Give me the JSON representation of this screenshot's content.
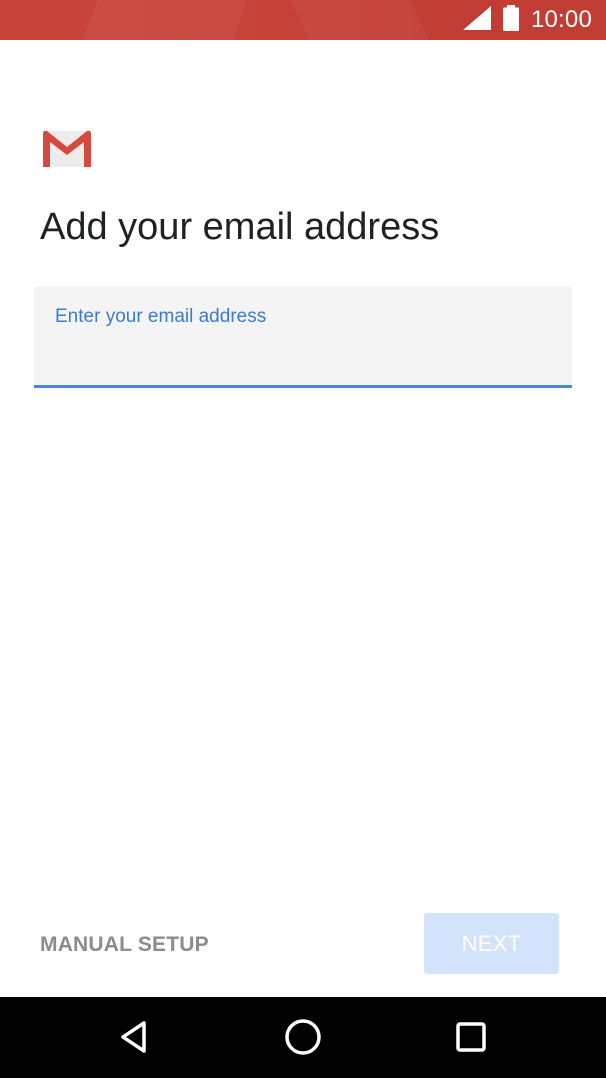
{
  "status_bar": {
    "time": "10:00",
    "icons": [
      "signal-icon",
      "battery-icon"
    ],
    "color": "#c5413a"
  },
  "app": {
    "logo": "gmail-logo"
  },
  "page": {
    "title": "Add your email address"
  },
  "email_field": {
    "label": "Enter your email address",
    "value": "",
    "accent_color": "#4a86d8"
  },
  "actions": {
    "manual_setup_label": "MANUAL SETUP",
    "next_label": "NEXT",
    "next_enabled": false
  },
  "nav_bar": {
    "buttons": [
      "back-icon",
      "home-icon",
      "recents-icon"
    ]
  }
}
